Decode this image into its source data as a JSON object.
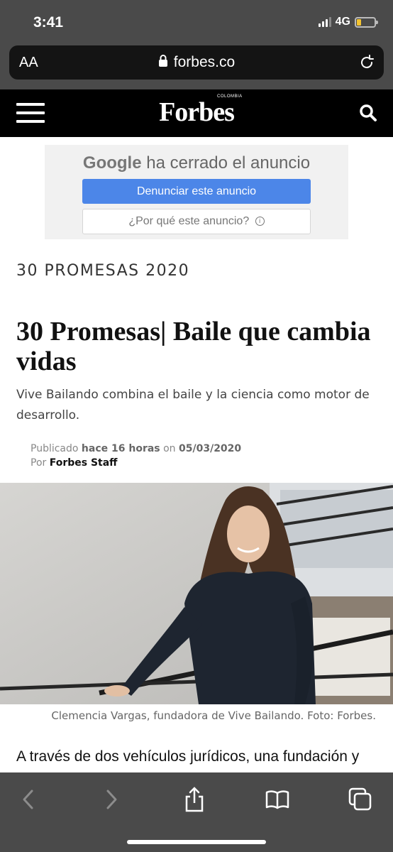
{
  "status_bar": {
    "time": "3:41",
    "network": "4G"
  },
  "safari": {
    "text_size_label": "AA",
    "domain": "forbes.co"
  },
  "site_header": {
    "brand": "Forbes",
    "brand_country": "COLOMBIA"
  },
  "ad_notice": {
    "google": "Google",
    "closed_text": "ha cerrado el anuncio",
    "report_button": "Denunciar este anuncio",
    "why_button": "¿Por qué este anuncio?"
  },
  "article": {
    "section": "30 PROMESAS 2020",
    "title": "30 Promesas| Baile que cambia vidas",
    "dek": "Vive Bailando combina el baile y la ciencia como motor de desarrollo.",
    "byline": {
      "published_label": "Publicado",
      "relative_time": "hace 16 horas",
      "on_label": "on",
      "date": "05/03/2020",
      "by_label": "Por",
      "author": "Forbes Staff"
    },
    "photo_caption": "Clemencia Vargas, fundadora de Vive Bailando. Foto: Forbes.",
    "body_first_line": "A través de dos vehículos jurídicos, una fundación y"
  },
  "colors": {
    "chrome_dark": "#4a4a4a",
    "header_black": "#000000",
    "ad_button_blue": "#4c86e8",
    "battery_yellow": "#f4c430"
  },
  "icons": {
    "lock": "lock-icon",
    "reload": "reload-icon",
    "menu": "hamburger-menu-icon",
    "search": "search-icon",
    "back": "chevron-left-icon",
    "forward": "chevron-right-icon",
    "share": "share-icon",
    "bookmarks": "book-icon",
    "tabs": "tabs-icon"
  }
}
